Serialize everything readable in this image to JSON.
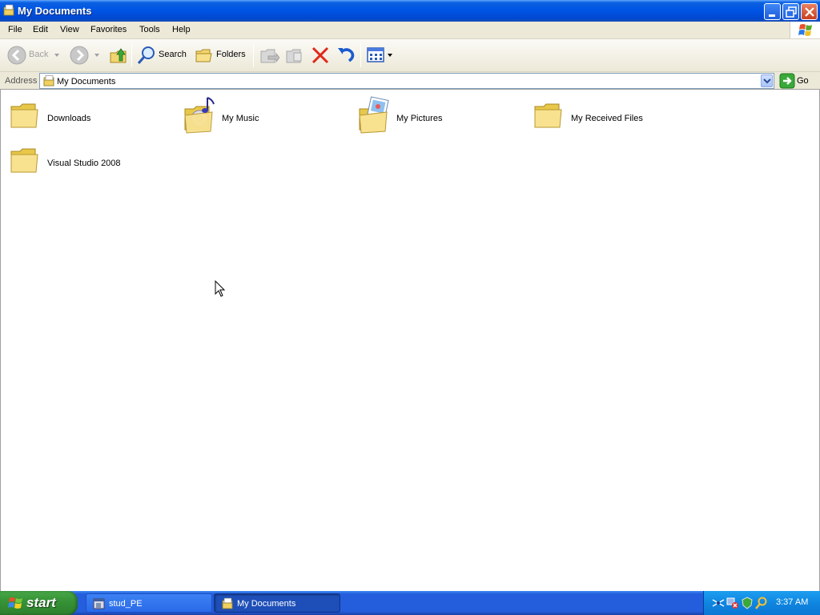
{
  "window": {
    "title": "My Documents"
  },
  "menu": {
    "items": [
      "File",
      "Edit",
      "View",
      "Favorites",
      "Tools",
      "Help"
    ]
  },
  "toolbar": {
    "back_label": "Back",
    "search_label": "Search",
    "folders_label": "Folders"
  },
  "address": {
    "label": "Address",
    "value": "My Documents",
    "go_label": "Go"
  },
  "folders": [
    {
      "name": "Downloads",
      "icon": "folder-icon"
    },
    {
      "name": "My Music",
      "icon": "music-folder-icon"
    },
    {
      "name": "My Pictures",
      "icon": "pictures-folder-icon"
    },
    {
      "name": "My Received Files",
      "icon": "folder-icon"
    },
    {
      "name": "Visual Studio 2008",
      "icon": "folder-icon"
    }
  ],
  "taskbar": {
    "start_label": "start",
    "tasks": [
      {
        "label": "stud_PE",
        "active": false
      },
      {
        "label": "My Documents",
        "active": true
      }
    ],
    "clock": "3:37 AM"
  },
  "colors": {
    "titlebar": "#0055e5",
    "taskbar": "#245edc",
    "start": "#379437",
    "chrome": "#ece9d8"
  }
}
